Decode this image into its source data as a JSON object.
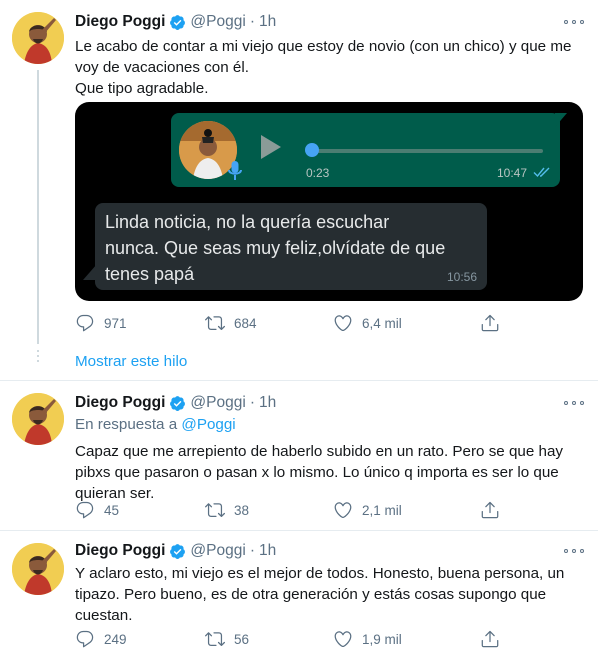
{
  "colors": {
    "accent": "#1da1f2",
    "verified": "#1da1f2",
    "muted": "#5b7083",
    "whatsapp_out": "#005c4b",
    "whatsapp_in": "#262d31"
  },
  "tweets": [
    {
      "name": "Diego Poggi",
      "handle": "@Poggi",
      "dot": "·",
      "time": "1h",
      "text": "Le acabo de contar a mi viejo que estoy de novio (con un chico) y que me\nvoy de vacaciones con él.\nQue tipo agradable.",
      "media": {
        "voice_duration": "0:23",
        "voice_time": "10:47",
        "voice_progress": 0.0,
        "reply_text": "Linda noticia, no la quería escuchar\nnunca. Que seas muy feliz,olvídate de que\ntenes papá",
        "reply_time": "10:56"
      },
      "replies": "971",
      "retweets": "684",
      "likes": "6,4 mil"
    },
    {
      "name": "Diego Poggi",
      "handle": "@Poggi",
      "dot": "·",
      "time": "1h",
      "reply_prefix": "En respuesta a",
      "reply_mention": "@Poggi",
      "text": "Capaz que me arrepiento de haberlo subido en un rato. Pero se que hay\npibxs que pasaron o pasan x lo mismo. Lo único q importa es ser lo que\nquieran ser.",
      "replies": "45",
      "retweets": "38",
      "likes": "2,1 mil"
    },
    {
      "name": "Diego Poggi",
      "handle": "@Poggi",
      "dot": "·",
      "time": "1h",
      "text": "Y aclaro esto, mi viejo es el mejor de todos. Honesto, buena persona, un\ntipazo. Pero bueno, es de otra generación y estás cosas supongo que\ncuestan.",
      "replies": "249",
      "retweets": "56",
      "likes": "1,9 mil"
    }
  ],
  "show_thread": "Mostrar este hilo",
  "icons": {
    "verified": "verified-badge-icon",
    "more": "more-options-icon",
    "reply": "reply-icon",
    "retweet": "retweet-icon",
    "like": "heart-icon",
    "share": "share-icon",
    "play": "play-icon",
    "mic": "microphone-icon",
    "checks": "double-check-icon"
  }
}
